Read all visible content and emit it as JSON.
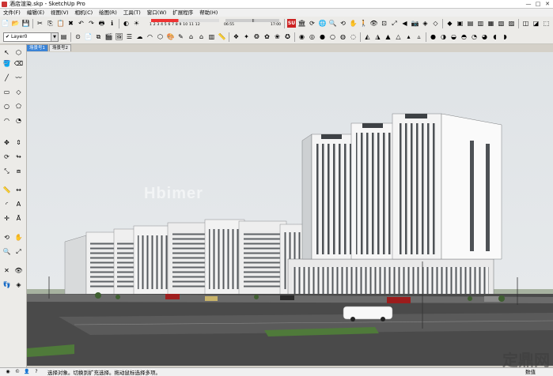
{
  "window": {
    "title": "酒店渲染.skp - SketchUp Pro",
    "controls": [
      "—",
      "□",
      "✕"
    ]
  },
  "menu": [
    "文件(F)",
    "编辑(E)",
    "视图(V)",
    "相机(C)",
    "绘图(R)",
    "工具(T)",
    "窗口(W)",
    "扩展程序",
    "帮助(H)"
  ],
  "shadow": {
    "months": "1 2 3 4 5 6 7 8 9 10 11 12",
    "time_start": "06:55",
    "time_mid": "中午",
    "time_end": "17:00"
  },
  "layer": {
    "check": "✔",
    "name": "Layer0"
  },
  "scenes": [
    "场景号1",
    "场景号2"
  ],
  "status": {
    "message": "选择对象。切换到扩充选择。拖动鼠标选择多项。",
    "measure_label": "数值"
  },
  "watermarks": {
    "top_left": "Hbimer",
    "bottom_right": "定鼎网",
    "bottom_right_small": "..."
  },
  "colors": {
    "sky": "#e2e6e9",
    "ground": "#4a4a4a",
    "grass": "#4f7a3a",
    "tab_active": "#3a83d6"
  }
}
